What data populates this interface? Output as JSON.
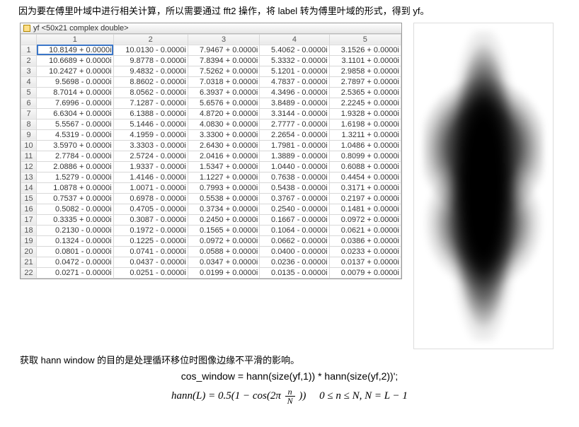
{
  "intro_text": "因为要在傅里叶域中进行相关计算，所以需要通过 fft2 操作，将 label 转为傅里叶域的形式，得到 yf。",
  "var_panel": {
    "var_name": "yf",
    "type_desc": "<50x21 complex double>",
    "col_headers": [
      "1",
      "2",
      "3",
      "4",
      "5"
    ],
    "row_headers": [
      "1",
      "2",
      "3",
      "4",
      "5",
      "6",
      "7",
      "8",
      "9",
      "10",
      "11",
      "12",
      "13",
      "14",
      "15",
      "16",
      "17",
      "18",
      "19",
      "20",
      "21",
      "22"
    ],
    "rows": [
      [
        "10.8149 + 0.0000i",
        "10.0130 - 0.0000i",
        "7.9467 + 0.0000i",
        "5.4062 - 0.0000i",
        "3.1526 + 0.0000i"
      ],
      [
        "10.6689 + 0.0000i",
        "9.8778 - 0.0000i",
        "7.8394 + 0.0000i",
        "5.3332 - 0.0000i",
        "3.1101 + 0.0000i"
      ],
      [
        "10.2427 + 0.0000i",
        "9.4832 - 0.0000i",
        "7.5262 + 0.0000i",
        "5.1201 - 0.0000i",
        "2.9858 + 0.0000i"
      ],
      [
        "9.5698 - 0.0000i",
        "8.8602 - 0.0000i",
        "7.0318 + 0.0000i",
        "4.7837 - 0.0000i",
        "2.7897 + 0.0000i"
      ],
      [
        "8.7014 + 0.0000i",
        "8.0562 - 0.0000i",
        "6.3937 + 0.0000i",
        "4.3496 - 0.0000i",
        "2.5365 + 0.0000i"
      ],
      [
        "7.6996 - 0.0000i",
        "7.1287 - 0.0000i",
        "5.6576 + 0.0000i",
        "3.8489 - 0.0000i",
        "2.2245 + 0.0000i"
      ],
      [
        "6.6304 + 0.0000i",
        "6.1388 - 0.0000i",
        "4.8720 + 0.0000i",
        "3.3144 - 0.0000i",
        "1.9328 + 0.0000i"
      ],
      [
        "5.5567 - 0.0000i",
        "5.1446 - 0.0000i",
        "4.0830 + 0.0000i",
        "2.7777 - 0.0000i",
        "1.6198 + 0.0000i"
      ],
      [
        "4.5319 - 0.0000i",
        "4.1959 - 0.0000i",
        "3.3300 + 0.0000i",
        "2.2654 - 0.0000i",
        "1.3211 + 0.0000i"
      ],
      [
        "3.5970 + 0.0000i",
        "3.3303 - 0.0000i",
        "2.6430 + 0.0000i",
        "1.7981 - 0.0000i",
        "1.0486 + 0.0000i"
      ],
      [
        "2.7784 - 0.0000i",
        "2.5724 - 0.0000i",
        "2.0416 + 0.0000i",
        "1.3889 - 0.0000i",
        "0.8099 + 0.0000i"
      ],
      [
        "2.0886 + 0.0000i",
        "1.9337 - 0.0000i",
        "1.5347 + 0.0000i",
        "1.0440 - 0.0000i",
        "0.6088 + 0.0000i"
      ],
      [
        "1.5279 - 0.0000i",
        "1.4146 - 0.0000i",
        "1.1227 + 0.0000i",
        "0.7638 - 0.0000i",
        "0.4454 + 0.0000i"
      ],
      [
        "1.0878 + 0.0000i",
        "1.0071 - 0.0000i",
        "0.7993 + 0.0000i",
        "0.5438 - 0.0000i",
        "0.3171 + 0.0000i"
      ],
      [
        "0.7537 + 0.0000i",
        "0.6978 - 0.0000i",
        "0.5538 + 0.0000i",
        "0.3767 - 0.0000i",
        "0.2197 + 0.0000i"
      ],
      [
        "0.5082 - 0.0000i",
        "0.4705 - 0.0000i",
        "0.3734 + 0.0000i",
        "0.2540 - 0.0000i",
        "0.1481 + 0.0000i"
      ],
      [
        "0.3335 + 0.0000i",
        "0.3087 - 0.0000i",
        "0.2450 + 0.0000i",
        "0.1667 - 0.0000i",
        "0.0972 + 0.0000i"
      ],
      [
        "0.2130 - 0.0000i",
        "0.1972 - 0.0000i",
        "0.1565 + 0.0000i",
        "0.1064 - 0.0000i",
        "0.0621 + 0.0000i"
      ],
      [
        "0.1324 - 0.0000i",
        "0.1225 - 0.0000i",
        "0.0972 + 0.0000i",
        "0.0662 - 0.0000i",
        "0.0386 + 0.0000i"
      ],
      [
        "0.0801 - 0.0000i",
        "0.0741 - 0.0000i",
        "0.0588 + 0.0000i",
        "0.0400 - 0.0000i",
        "0.0233 + 0.0000i"
      ],
      [
        "0.0472 - 0.0000i",
        "0.0437 - 0.0000i",
        "0.0347 + 0.0000i",
        "0.0236 - 0.0000i",
        "0.0137 + 0.0000i"
      ],
      [
        "0.0271 - 0.0000i",
        "0.0251 - 0.0000i",
        "0.0199 + 0.0000i",
        "0.0135 - 0.0000i",
        "0.0079 + 0.0000i"
      ]
    ]
  },
  "footer1": "获取 hann window 的目的是处理循环移位时图像边缘不平滑的影响。",
  "code_line": "cos_window = hann(size(yf,1)) * hann(size(yf,2))';",
  "formula": {
    "lhs": "hann(L) = 0.5(1 − cos(2π",
    "frac_num": "n",
    "frac_den": "N",
    "rhs_close": "))",
    "cond": "0 ≤ n ≤ N, N = L − 1"
  }
}
